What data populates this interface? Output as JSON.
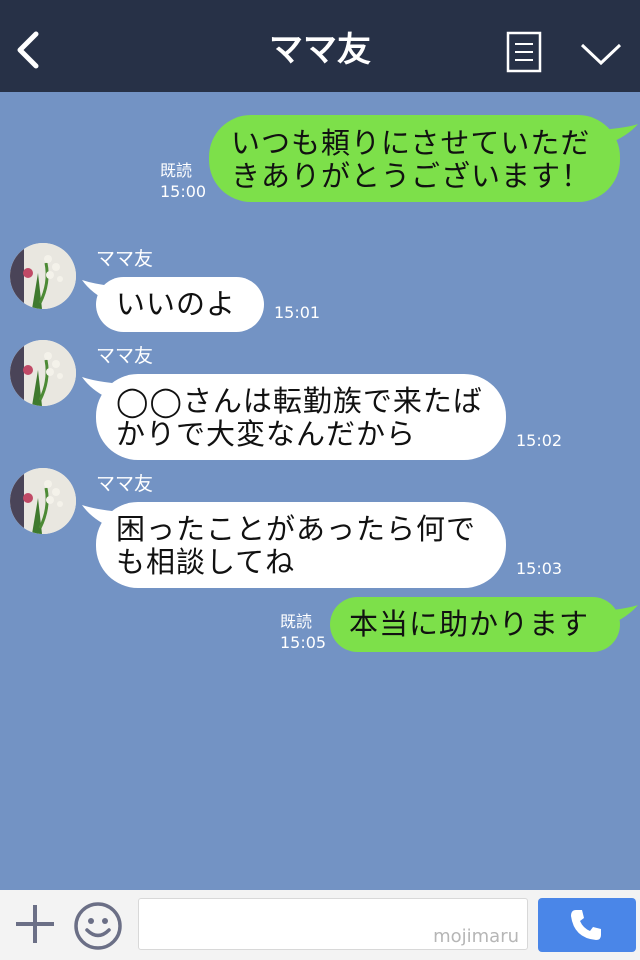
{
  "header": {
    "title": "ママ友",
    "back_icon": "chevron-left-icon",
    "menu_icon": "notes-icon",
    "expand_icon": "chevron-down-icon"
  },
  "messages": [
    {
      "direction": "out",
      "lines": [
        "いつも頼りにさせていただ",
        "きありがとうございます！"
      ],
      "read": "既読",
      "time": "15:00"
    },
    {
      "direction": "in",
      "sender": "ママ友",
      "lines": [
        "いいのよ"
      ],
      "time": "15:01"
    },
    {
      "direction": "in",
      "sender": "ママ友",
      "lines": [
        "◯◯さんは転勤族で来たば",
        "かりで大変なんだから"
      ],
      "time": "15:02"
    },
    {
      "direction": "in",
      "sender": "ママ友",
      "lines": [
        "困ったことがあったら何で",
        "も相談してね"
      ],
      "time": "15:03"
    },
    {
      "direction": "out",
      "lines": [
        "本当に助かります"
      ],
      "read": "既読",
      "time": "15:05"
    }
  ],
  "input_bar": {
    "placeholder": "",
    "watermark": "mojimaru",
    "add_icon": "plus-icon",
    "emoji_icon": "smile-icon",
    "call_icon": "phone-icon"
  },
  "colors": {
    "header_bg": "#273147",
    "chat_bg": "#7393c4",
    "outgoing_bubble": "#7de04a",
    "incoming_bubble": "#ffffff",
    "call_button": "#4a86e8"
  }
}
